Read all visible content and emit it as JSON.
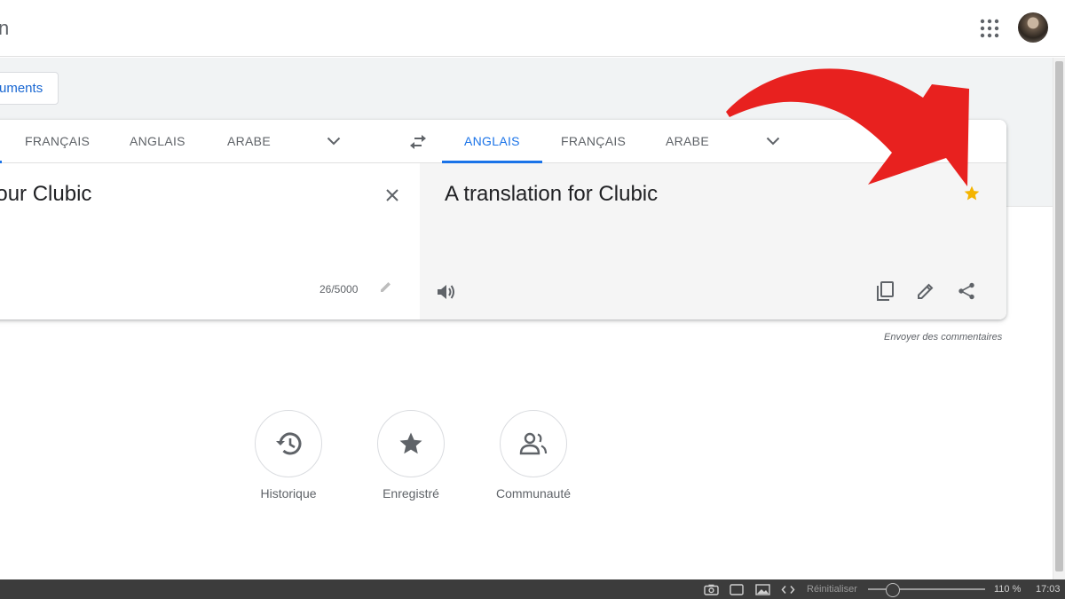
{
  "header": {
    "app_title": "n",
    "apps_icon": "apps-grid-icon",
    "avatar": "user-avatar"
  },
  "docs_button": {
    "label": "uments"
  },
  "source": {
    "tabs": [
      "FRANÇAIS",
      "ANGLAIS",
      "ARABE"
    ],
    "text": "n pour Clubic",
    "char_count": "26/5000"
  },
  "target": {
    "tabs": [
      "ANGLAIS",
      "FRANÇAIS",
      "ARABE"
    ],
    "active_tab": "ANGLAIS",
    "text": "A translation for Clubic",
    "star_color": "#f4b400"
  },
  "feedback": {
    "label": "Envoyer des commentaires"
  },
  "shortcuts": [
    {
      "label": "Historique",
      "icon": "history-icon"
    },
    {
      "label": "Enregistré",
      "icon": "star-icon"
    },
    {
      "label": "Communauté",
      "icon": "community-icon"
    }
  ],
  "statusbar": {
    "reset_label": "Réinitialiser",
    "zoom": "110 %",
    "time": "17:03"
  },
  "colors": {
    "accent": "#1a73e8",
    "annotation_arrow": "#e8211f"
  }
}
